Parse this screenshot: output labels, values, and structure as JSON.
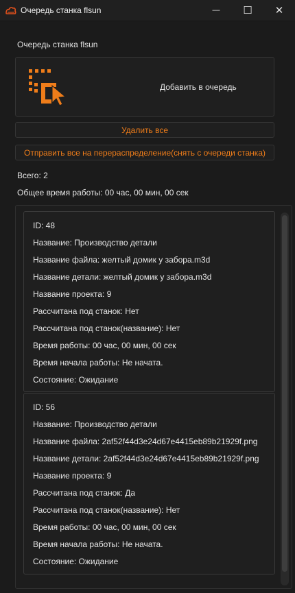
{
  "window": {
    "title": "Очередь станка flsun",
    "minimize": "—",
    "maximize": "☐",
    "close": "✕"
  },
  "header": {
    "label": "Очередь станка flsun"
  },
  "add_panel": {
    "label": "Добавить в очередь",
    "icon": "add-to-queue-icon"
  },
  "actions": {
    "delete_all": "Удалить все",
    "redistribute_all": "Отправить все на перераспределение(снять с очереди станка)"
  },
  "summary": {
    "total": "Всего: 2",
    "total_time": "Общее время работы: 00 час, 00 мин, 00 сек"
  },
  "queue": [
    {
      "id": "ID: 48",
      "name": "Название: Производство детали",
      "file_name": "Название файла: желтый домик у забора.m3d",
      "part_name": "Название детали: желтый домик у забора.m3d",
      "project_name": "Название проекта: 9",
      "calculated_for_machine": "Рассчитана под станок: Нет",
      "calculated_for_machine_name": "Рассчитана под станок(название): Нет",
      "work_time": "Время работы: 00 час, 00 мин, 00 сек",
      "start_time": "Время начала работы: Не начата.",
      "state": "Состояние: Ожидание"
    },
    {
      "id": "ID: 56",
      "name": "Название: Производство детали",
      "file_name": "Название файла: 2af52f44d3e24d67e4415eb89b21929f.png",
      "part_name": "Название детали: 2af52f44d3e24d67e4415eb89b21929f.png",
      "project_name": "Название проекта: 9",
      "calculated_for_machine": "Рассчитана под станок: Да",
      "calculated_for_machine_name": "Рассчитана под станок(название): Нет",
      "work_time": "Время работы: 00 час, 00 мин, 00 сек",
      "start_time": "Время начала работы: Не начата.",
      "state": "Состояние: Ожидание"
    }
  ],
  "colors": {
    "accent": "#ef7d1a",
    "background": "#1b1b1b",
    "panel": "#1f1f1f",
    "border": "#353535",
    "text": "#e6e6e6"
  }
}
